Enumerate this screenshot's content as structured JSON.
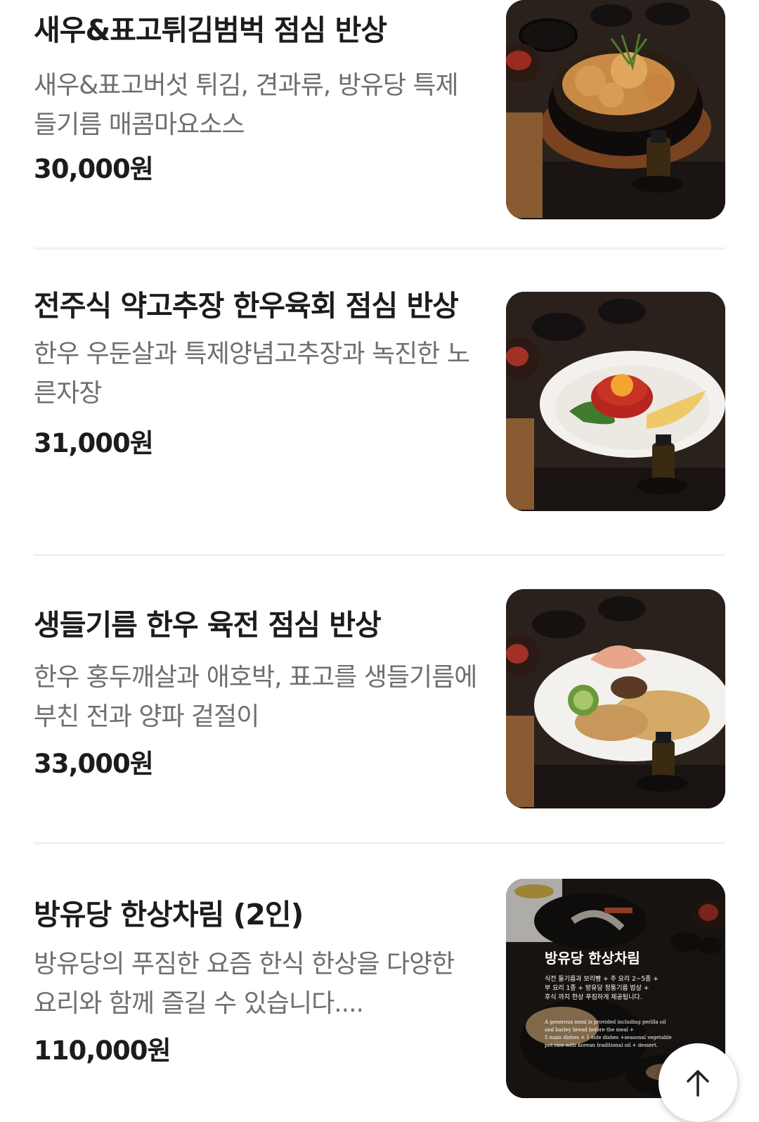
{
  "menu_items": [
    {
      "name": "새우&표고튀김범벅 점심 반상",
      "description": "새우&표고버섯 튀김, 견과류, 방유당 특제 들기름 매콤마요소스",
      "price": "30,000원",
      "image_alt": "fried shrimp and shiitake bowl"
    },
    {
      "name": "전주식 약고추장 한우육회 점심 반상",
      "description": "한우 우둔살과 특제양념고추장과 녹진한 노른자장",
      "price": "31,000원",
      "image_alt": "hanwoo yukhoe plate with yolk"
    },
    {
      "name": "생들기름 한우 육전 점심 반상",
      "description": "한우 홍두깨살과 애호박, 표고를 생들기름에 부친 전과 양파 겉절이",
      "price": "33,000원",
      "image_alt": "hanwoo yukjeon plate"
    },
    {
      "name": "방유당 한상차림 (2인)",
      "description": "방유당의 푸짐한 요즘 한식 한상을 다양한 요리와 함께 즐길 수 있습니다....",
      "price": "110,000원",
      "image_alt": "hansang table set",
      "image_text": {
        "title": "방유당 한상차림",
        "korean_lines": [
          "식전 들기름과 보리빵 + 주 요리 2~5종 +",
          "부 요리 1종 + 방유당 정통기름 밥상 +",
          "후식 까지 한상 푸짐하게 제공됩니다."
        ],
        "english_lines": [
          "A generous meal is provided including perilla oil",
          "and barley bread before the meal +",
          "5 main dishes + 1 side dishes +seasonal vegetable",
          "pot rice with korean traditional oil + dessert."
        ]
      }
    }
  ],
  "scroll_top_icon": "arrow-up-icon",
  "colors": {
    "title": "#1c1c1c",
    "description": "#6f6f6f",
    "divider": "#f1f1f1"
  }
}
